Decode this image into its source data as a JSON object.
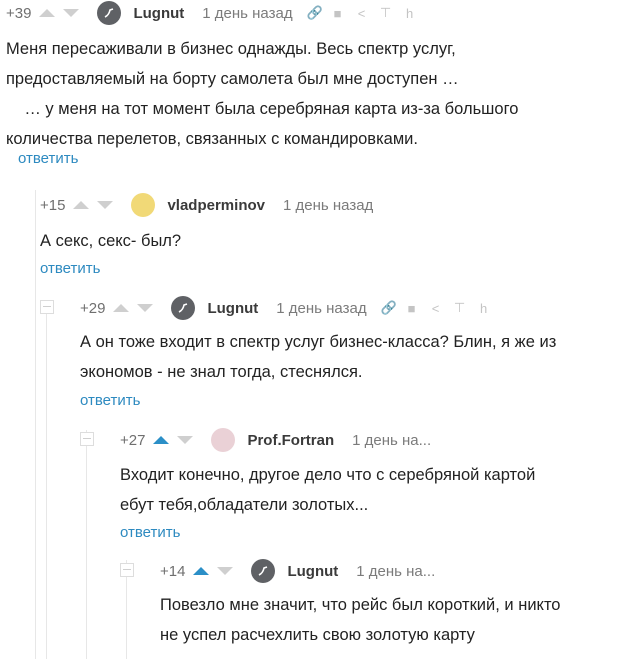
{
  "comments": [
    {
      "rating": "+39",
      "author": "Lugnut",
      "time": "1 день назад",
      "lines": [
        "Меня пересаживали в бизнес однажды. Весь спектр услуг,",
        "предоставляемый на борту самолета был мне доступен …",
        "    … у меня на тот момент была серебряная карта из-за большого",
        "количества перелетов, связанных с командировками."
      ],
      "reply": "ответить"
    },
    {
      "rating": "+15",
      "author": "vladperminov",
      "time": "1 день назад",
      "lines": [
        "А секс, секс- был?"
      ],
      "reply": "ответить"
    },
    {
      "rating": "+29",
      "author": "Lugnut",
      "time": "1 день назад",
      "lines": [
        "А он тоже входит в спектр услуг бизнес-класса? Блин, я же из",
        "экономов - не знал тогда, стеснялся."
      ],
      "reply": "ответить"
    },
    {
      "rating": "+27",
      "author": "Prof.Fortran",
      "time": "1 день на...",
      "lines": [
        "Входит конечно, другое дело что с серебряной картой",
        "ебут тебя,обладатели золотых..."
      ],
      "reply": "ответить"
    },
    {
      "rating": "+14",
      "author": "Lugnut",
      "time": "1 день на...",
      "lines": [
        "Повезло мне значит, что рейс был короткий, и никто",
        "не успел расчехлить свою золотую карту"
      ]
    }
  ]
}
